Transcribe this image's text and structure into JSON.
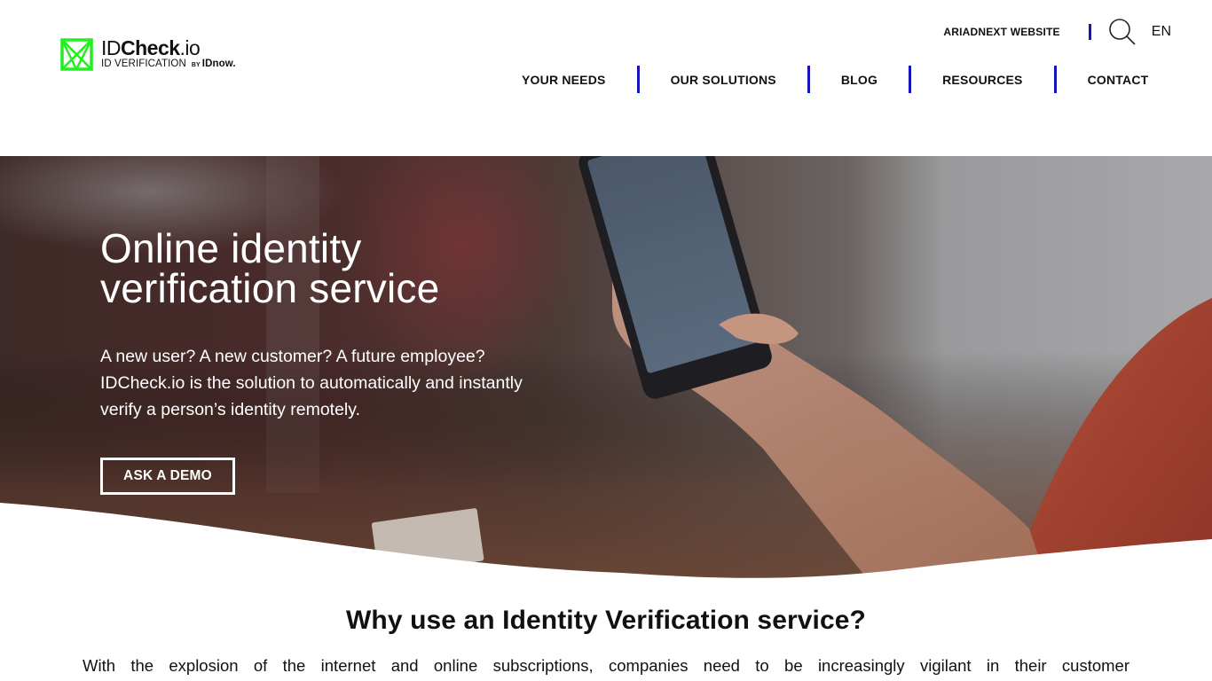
{
  "brand": {
    "name_light": "ID",
    "name_bold": "Check",
    "name_suffix": ".io",
    "tagline": "ID VERIFICATION",
    "by": "BY",
    "parent": "IDnow.",
    "logo_color": "#22dd22"
  },
  "topbar": {
    "ariadnext_link": "ARIADNEXT WEBSITE",
    "search_icon": "search-icon",
    "language": "EN"
  },
  "nav": {
    "items": [
      {
        "label": "YOUR NEEDS"
      },
      {
        "label": "OUR SOLUTIONS"
      },
      {
        "label": "BLOG"
      },
      {
        "label": "RESOURCES"
      },
      {
        "label": "CONTACT"
      }
    ],
    "separator_color": "#1414b8"
  },
  "hero": {
    "title_line1": "Online identity",
    "title_line2": "verification service",
    "text_line1": "A new user? A new customer? A future employee?",
    "text_line2": "IDCheck.io is the solution to automatically and instantly",
    "text_line3": "verify a person’s identity remotely.",
    "cta_label": "ASK A DEMO",
    "image_description": "hand holding smartphone"
  },
  "section": {
    "title": "Why use an Identity Verification service?",
    "text": "With the explosion of the internet and online subscriptions, companies need to be increasingly vigilant in their customer"
  }
}
